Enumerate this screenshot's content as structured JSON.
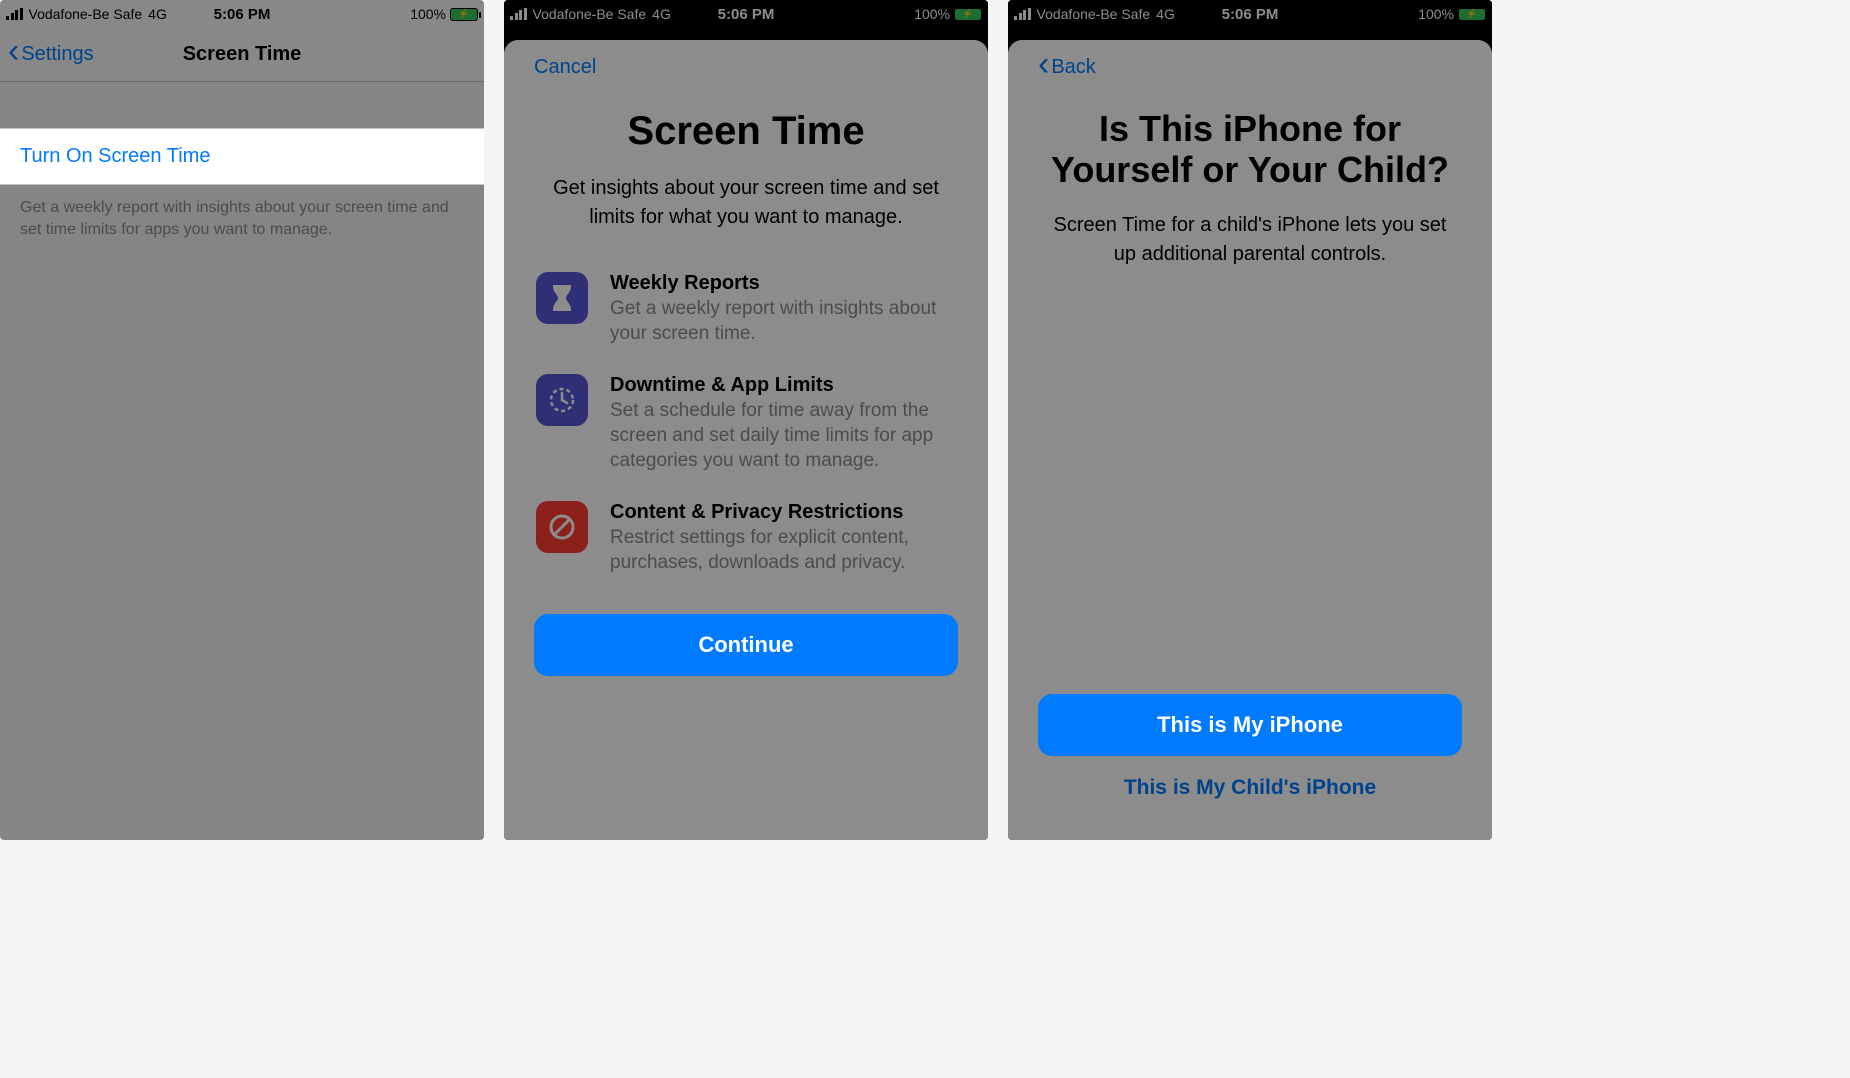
{
  "status": {
    "carrier": "Vodafone-Be Safe",
    "network": "4G",
    "time": "5:06 PM",
    "battery_pct": "100%"
  },
  "screen1": {
    "back_label": "Settings",
    "title": "Screen Time",
    "turn_on": "Turn On Screen Time",
    "footer": "Get a weekly report with insights about your screen time and set time limits for apps you want to manage."
  },
  "screen2": {
    "cancel": "Cancel",
    "title": "Screen Time",
    "subtitle": "Get insights about your screen time and set limits for what you want to manage.",
    "features": [
      {
        "icon": "hourglass",
        "title": "Weekly Reports",
        "desc": "Get a weekly report with insights about your screen time."
      },
      {
        "icon": "clock",
        "title": "Downtime & App Limits",
        "desc": "Set a schedule for time away from the screen and set daily time limits for app categories you want to manage."
      },
      {
        "icon": "no-entry",
        "title": "Content & Privacy Restrictions",
        "desc": "Restrict settings for explicit content, purchases, downloads and privacy."
      }
    ],
    "continue": "Continue"
  },
  "screen3": {
    "back": "Back",
    "title": "Is This iPhone for Yourself or Your Child?",
    "subtitle": "Screen Time for a child's iPhone lets you set up additional parental controls.",
    "primary": "This is My iPhone",
    "secondary": "This is My Child's iPhone"
  }
}
